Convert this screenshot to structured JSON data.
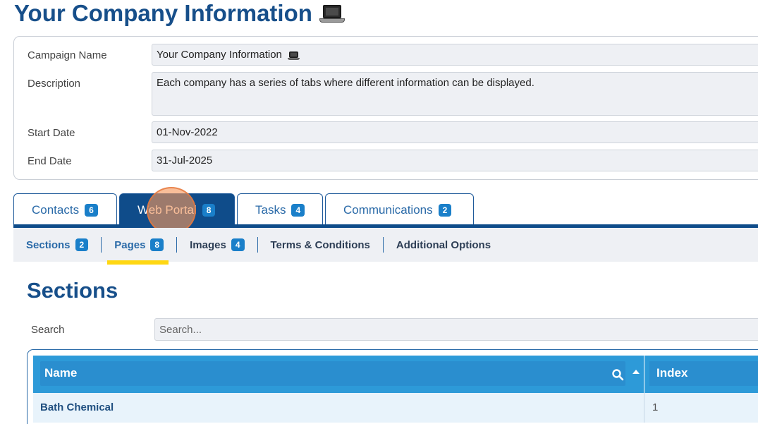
{
  "page": {
    "title": "Your Company Information",
    "title_icon": "laptop-icon"
  },
  "campaign": {
    "name_label": "Campaign Name",
    "name_value": "Your Company Information",
    "description_label": "Description",
    "description_value": "Each company has a series of tabs where different information can be displayed.",
    "start_label": "Start Date",
    "start_value": "01-Nov-2022",
    "end_label": "End Date",
    "end_value": "31-Jul-2025"
  },
  "tabs": [
    {
      "label": "Contacts",
      "count": "6"
    },
    {
      "label": "Web Portal",
      "count": "8",
      "active": true
    },
    {
      "label": "Tasks",
      "count": "4"
    },
    {
      "label": "Communications",
      "count": "2"
    }
  ],
  "subnav": [
    {
      "label": "Sections",
      "count": "2"
    },
    {
      "label": "Pages",
      "count": "8"
    },
    {
      "label": "Images",
      "count": "4"
    },
    {
      "label": "Terms & Conditions"
    },
    {
      "label": "Additional Options"
    }
  ],
  "sections": {
    "title": "Sections",
    "search_label": "Search",
    "search_placeholder": "Search...",
    "columns": [
      "Name",
      "Index"
    ],
    "rows": [
      {
        "name": "Bath Chemical",
        "index": "1"
      }
    ]
  },
  "colors": {
    "brand": "#174f8a",
    "active_tab": "#0f4c8a",
    "badge": "#1a7fc9",
    "table_header": "#2d9ad8",
    "highlight": "#ffd712"
  }
}
